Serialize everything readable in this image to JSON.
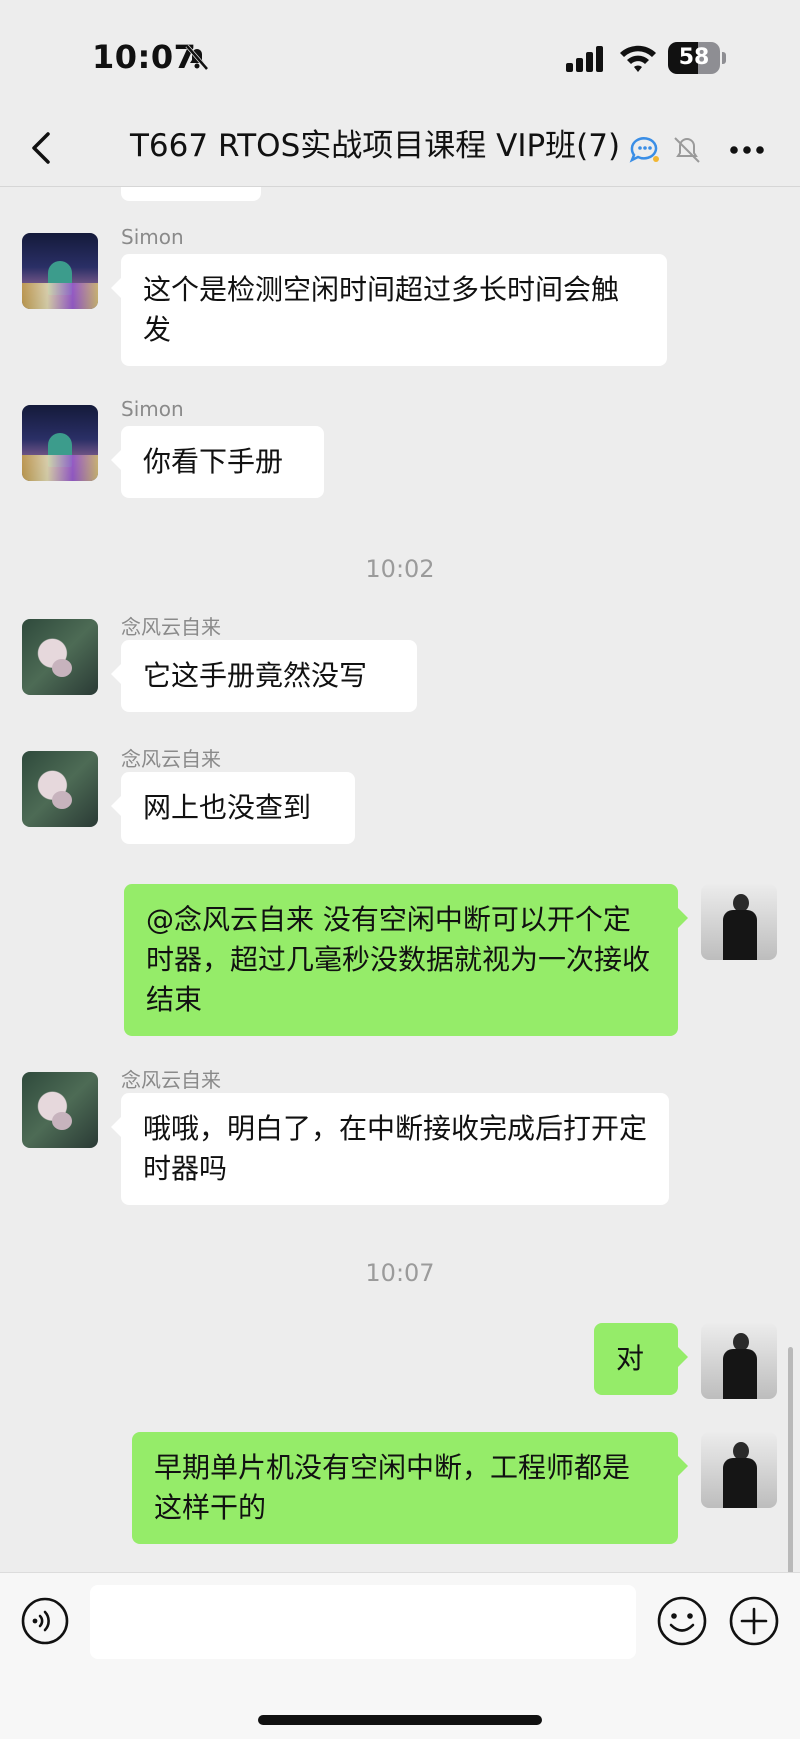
{
  "status_bar": {
    "time": "10:07",
    "battery": "58",
    "battery_level_percent": 58,
    "icons": [
      "bell-slash-icon",
      "cellular-signal-icon",
      "wifi-icon",
      "battery-icon"
    ]
  },
  "nav": {
    "title": "T667 RTOS实战项目课程 VIP班(7)",
    "icons": [
      "back-chevron-icon",
      "group-chat-icon",
      "muted-bell-icon",
      "more-icon"
    ]
  },
  "messages": [
    {
      "type": "text",
      "direction": "in",
      "sender": "Simon",
      "text": "这个是检测空闲时间超过多长时间会触发"
    },
    {
      "type": "text",
      "direction": "in",
      "sender": "Simon",
      "text": "你看下手册"
    },
    {
      "type": "time",
      "text": "10:02"
    },
    {
      "type": "text",
      "direction": "in",
      "sender": "念风云自来",
      "text": "它这手册竟然没写"
    },
    {
      "type": "text",
      "direction": "in",
      "sender": "念风云自来",
      "text": "网上也没查到"
    },
    {
      "type": "text",
      "direction": "out",
      "text": "@念风云自来 没有空闲中断可以开个定时器，超过几毫秒没数据就视为一次接收结束"
    },
    {
      "type": "text",
      "direction": "in",
      "sender": "念风云自来",
      "text": "哦哦，明白了，在中断接收完成后打开定时器吗"
    },
    {
      "type": "time",
      "text": "10:07"
    },
    {
      "type": "text",
      "direction": "out",
      "text": "对"
    },
    {
      "type": "text",
      "direction": "out",
      "text": "早期单片机没有空闲中断，工程师都是这样干的"
    }
  ],
  "input_bar": {
    "value": "",
    "icons": [
      "voice-icon",
      "emoji-icon",
      "plus-icon"
    ]
  },
  "colors": {
    "background": "#ededed",
    "incoming_bubble": "#ffffff",
    "outgoing_bubble": "#95ec69",
    "timestamp": "#9b9b9b"
  }
}
